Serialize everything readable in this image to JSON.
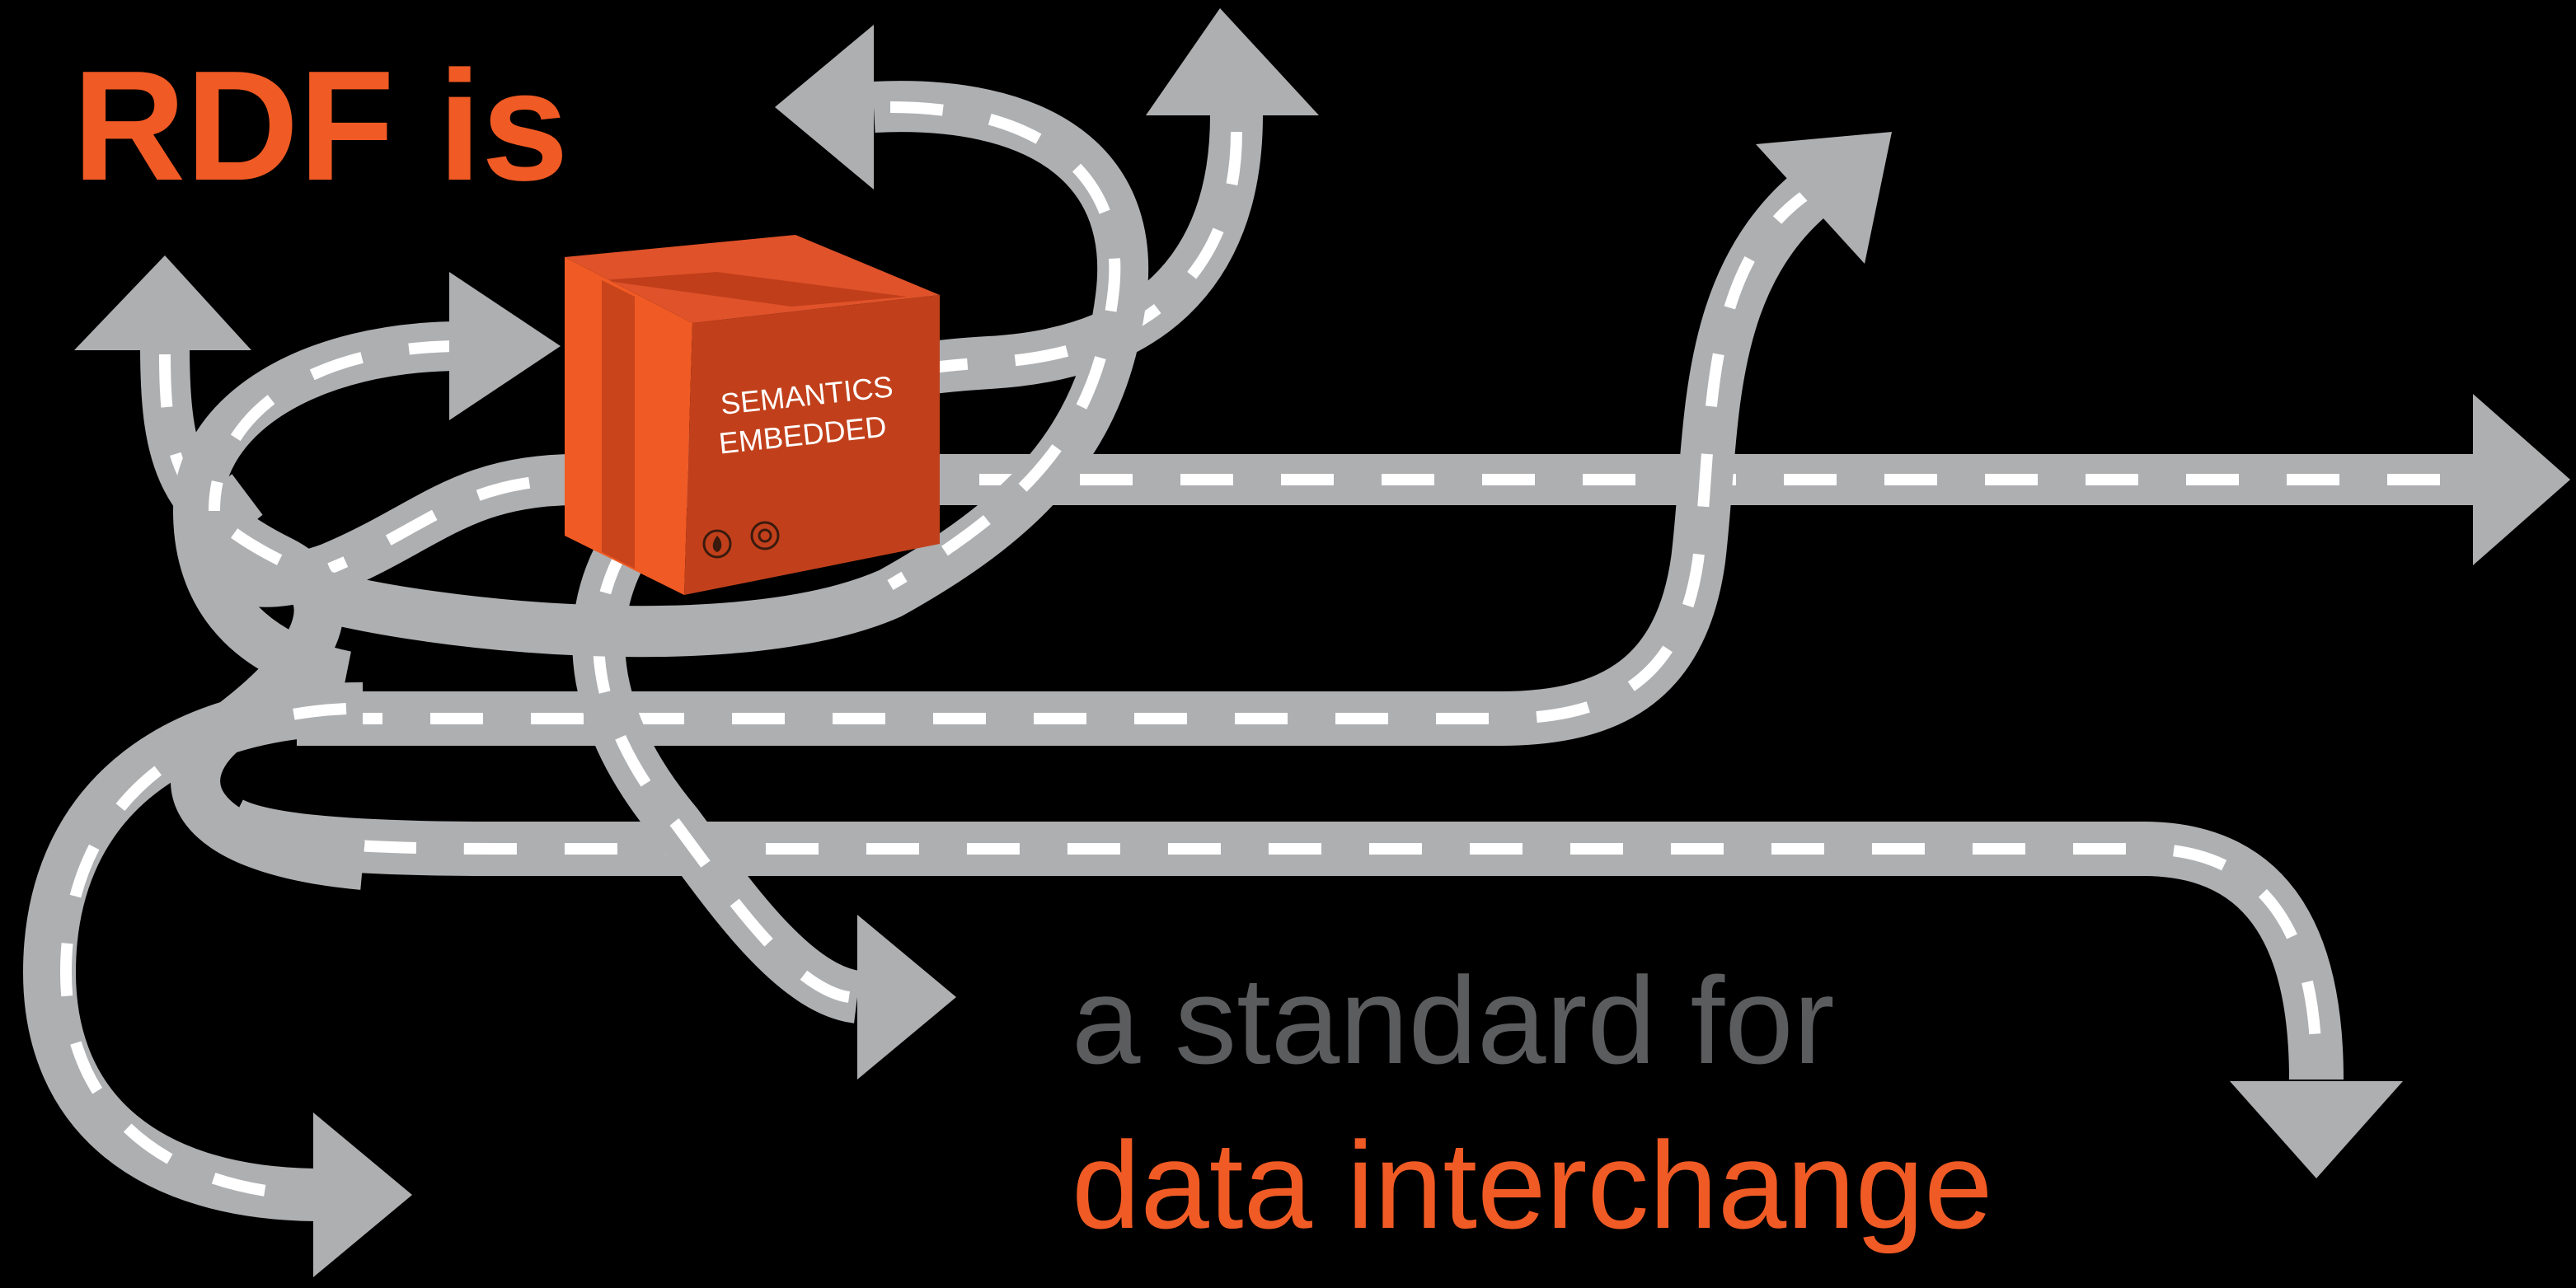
{
  "title": "RDF is",
  "subtitle_line1": "a standard for",
  "subtitle_line2": "data interchange",
  "box": {
    "line1": "SEMANTICS",
    "line2": "EMBEDDED",
    "icons": [
      "fire-icon",
      "recycle-icon"
    ]
  },
  "colors": {
    "background": "#000000",
    "accent_orange": "#f05a24",
    "road_gray": "#aeafb1",
    "dash_white": "#ffffff",
    "subtitle_gray": "#5b5c5e",
    "box_front": "#c1401b",
    "box_top": "#e0522a",
    "box_side": "#f05a24"
  }
}
